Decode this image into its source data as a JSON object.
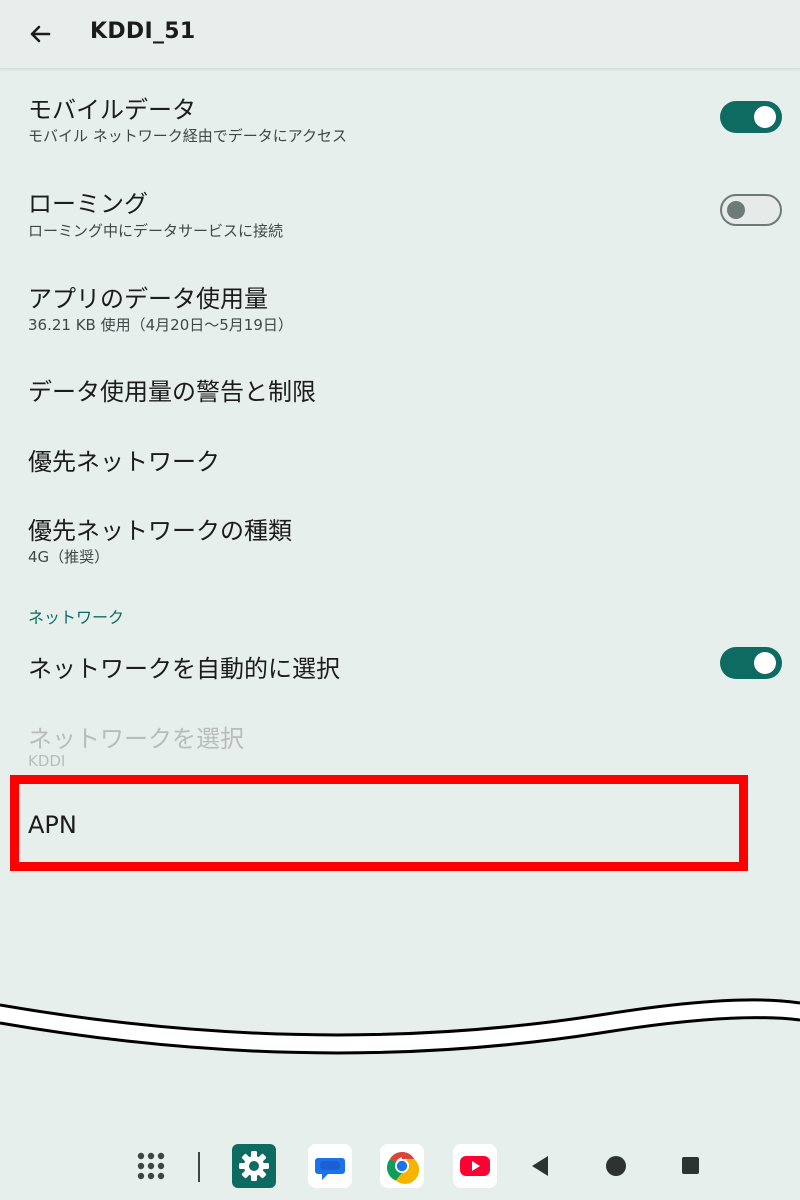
{
  "header": {
    "title": "KDDI_51"
  },
  "settings": {
    "mobile_data": {
      "title": "モバイルデータ",
      "subtitle": "モバイル ネットワーク経由でデータにアクセス",
      "enabled": true
    },
    "roaming": {
      "title": "ローミング",
      "subtitle": "ローミング中にデータサービスに接続",
      "enabled": false
    },
    "app_data_usage": {
      "title": "アプリのデータ使用量",
      "subtitle": "36.21 KB 使用（4月20日～5月19日）"
    },
    "data_warning": {
      "title": "データ使用量の警告と制限"
    },
    "preferred_network": {
      "title": "優先ネットワーク"
    },
    "preferred_network_type": {
      "title": "優先ネットワークの種類",
      "subtitle": "4G（推奨）"
    }
  },
  "network_section": {
    "header": "ネットワーク",
    "auto_select": {
      "title": "ネットワークを自動的に選択",
      "enabled": true
    },
    "select_network": {
      "title": "ネットワークを選択",
      "subtitle": "KDDI",
      "disabled": true
    },
    "apn": {
      "title": "APN"
    }
  },
  "taskbar": {
    "icons": [
      "app-drawer-icon",
      "settings-icon",
      "messages-icon",
      "chrome-icon",
      "youtube-icon",
      "back-nav-icon",
      "home-nav-icon",
      "recents-nav-icon"
    ]
  },
  "colors": {
    "accent": "#0e6b61",
    "background": "#e7efec",
    "highlight": "#ff0000",
    "disabled_text": "#b8bdbb"
  }
}
